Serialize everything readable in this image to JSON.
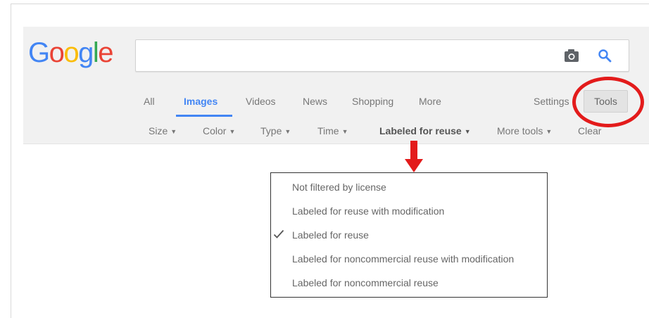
{
  "logo": {
    "text": "Google",
    "letters": [
      "G",
      "o",
      "o",
      "g",
      "l",
      "e"
    ]
  },
  "colors": {
    "logo": [
      "#4285f4",
      "#ea4335",
      "#fbbc05",
      "#4285f4",
      "#34a853",
      "#ea4335"
    ],
    "accent": "#4285f4",
    "annotation": "#e31b1b"
  },
  "search": {
    "value": "",
    "camera_icon": "camera-icon",
    "search_icon": "search-icon"
  },
  "tabs": [
    {
      "label": "All"
    },
    {
      "label": "Images",
      "active": true
    },
    {
      "label": "Videos"
    },
    {
      "label": "News"
    },
    {
      "label": "Shopping"
    },
    {
      "label": "More"
    }
  ],
  "settings_label": "Settings",
  "tools_label": "Tools",
  "tool_filters": [
    {
      "label": "Size",
      "caret": "▼"
    },
    {
      "label": "Color",
      "caret": "▼"
    },
    {
      "label": "Type",
      "caret": "▼"
    },
    {
      "label": "Time",
      "caret": "▼"
    },
    {
      "label": "Labeled for reuse",
      "caret": "▼"
    },
    {
      "label": "More tools",
      "caret": "▼"
    },
    {
      "label": "Clear"
    }
  ],
  "license_menu": {
    "items": [
      {
        "label": "Not filtered by license",
        "checked": false
      },
      {
        "label": "Labeled for reuse with modification",
        "checked": false
      },
      {
        "label": "Labeled for reuse",
        "checked": true
      },
      {
        "label": "Labeled for noncommercial reuse with modification",
        "checked": false
      },
      {
        "label": "Labeled for noncommercial reuse",
        "checked": false
      }
    ]
  }
}
